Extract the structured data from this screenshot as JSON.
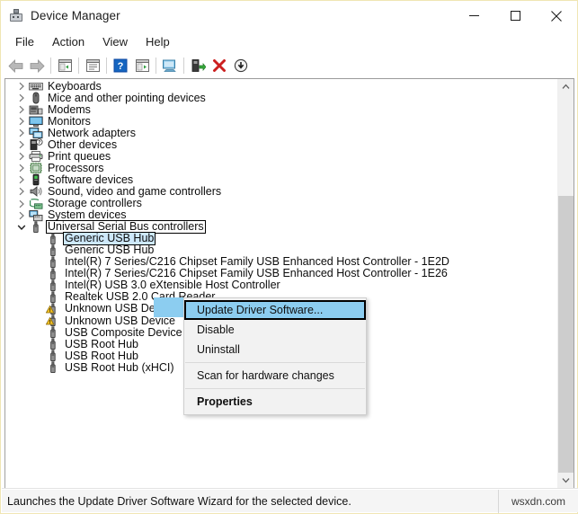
{
  "window": {
    "title": "Device Manager",
    "icon": "device-manager-icon",
    "border_color": "#f0e6b4",
    "caption_buttons": [
      {
        "name": "minimize-button",
        "glyph": "minimize"
      },
      {
        "name": "maximize-button",
        "glyph": "maximize"
      },
      {
        "name": "close-button",
        "glyph": "close"
      }
    ]
  },
  "menubar": {
    "items": [
      {
        "label": "File"
      },
      {
        "label": "Action"
      },
      {
        "label": "View"
      },
      {
        "label": "Help"
      }
    ]
  },
  "toolbar": {
    "buttons": [
      {
        "name": "back-icon",
        "tooltip": "Back"
      },
      {
        "name": "forward-icon",
        "tooltip": "Forward"
      },
      {
        "name": "show-hide-console-tree-icon",
        "tooltip": "Show/Hide Console Tree"
      },
      {
        "name": "properties-icon",
        "tooltip": "Properties"
      },
      {
        "name": "help-icon",
        "tooltip": "Help"
      },
      {
        "name": "action-menu-icon",
        "tooltip": "Action"
      },
      {
        "name": "update-driver-icon",
        "tooltip": "Update Driver Software"
      },
      {
        "name": "scan-hardware-changes-icon",
        "tooltip": "Scan for hardware changes"
      },
      {
        "name": "uninstall-icon",
        "tooltip": "Uninstall"
      },
      {
        "name": "disable-icon",
        "tooltip": "Disable"
      }
    ]
  },
  "tree": {
    "rows": [
      {
        "label": "Keyboards",
        "indent": 1,
        "expander": "collapsed",
        "icon": "keyboard-icon",
        "state": "normal"
      },
      {
        "label": "Mice and other pointing devices",
        "indent": 1,
        "expander": "collapsed",
        "icon": "mouse-icon",
        "state": "normal"
      },
      {
        "label": "Modems",
        "indent": 1,
        "expander": "collapsed",
        "icon": "modem-icon",
        "state": "normal"
      },
      {
        "label": "Monitors",
        "indent": 1,
        "expander": "collapsed",
        "icon": "monitor-icon",
        "state": "normal"
      },
      {
        "label": "Network adapters",
        "indent": 1,
        "expander": "collapsed",
        "icon": "network-icon",
        "state": "normal"
      },
      {
        "label": "Other devices",
        "indent": 1,
        "expander": "collapsed",
        "icon": "other-device-icon",
        "state": "normal"
      },
      {
        "label": "Print queues",
        "indent": 1,
        "expander": "collapsed",
        "icon": "printer-icon",
        "state": "normal"
      },
      {
        "label": "Processors",
        "indent": 1,
        "expander": "collapsed",
        "icon": "processor-icon",
        "state": "normal"
      },
      {
        "label": "Software devices",
        "indent": 1,
        "expander": "collapsed",
        "icon": "software-device-icon",
        "state": "normal"
      },
      {
        "label": "Sound, video and game controllers",
        "indent": 1,
        "expander": "collapsed",
        "icon": "sound-icon",
        "state": "normal"
      },
      {
        "label": "Storage controllers",
        "indent": 1,
        "expander": "collapsed",
        "icon": "storage-icon",
        "state": "normal"
      },
      {
        "label": "System devices",
        "indent": 1,
        "expander": "collapsed",
        "icon": "system-device-icon",
        "state": "normal"
      },
      {
        "label": "Universal Serial Bus controllers",
        "indent": 1,
        "expander": "expanded",
        "icon": "usb-icon",
        "state": "focused"
      },
      {
        "label": "Generic USB Hub",
        "indent": 2,
        "expander": "none",
        "icon": "usb-icon",
        "state": "selected-focused"
      },
      {
        "label": "Generic USB Hub",
        "indent": 2,
        "expander": "none",
        "icon": "usb-icon",
        "state": "normal"
      },
      {
        "label": "Intel(R) 7 Series/C216 Chipset Family USB Enhanced Host Controller - 1E2D",
        "indent": 2,
        "expander": "none",
        "icon": "usb-icon",
        "state": "normal"
      },
      {
        "label": "Intel(R) 7 Series/C216 Chipset Family USB Enhanced Host Controller - 1E26",
        "indent": 2,
        "expander": "none",
        "icon": "usb-icon",
        "state": "normal"
      },
      {
        "label": "Intel(R) USB 3.0 eXtensible Host Controller",
        "indent": 2,
        "expander": "none",
        "icon": "usb-icon",
        "state": "normal"
      },
      {
        "label": "Realtek USB 2.0 Card Reader",
        "indent": 2,
        "expander": "none",
        "icon": "usb-icon",
        "state": "normal"
      },
      {
        "label": "Unknown USB Device",
        "indent": 2,
        "expander": "none",
        "icon": "usb-warning-icon",
        "state": "normal"
      },
      {
        "label": "Unknown USB Device",
        "indent": 2,
        "expander": "none",
        "icon": "usb-warning-icon",
        "state": "normal"
      },
      {
        "label": "USB Composite Device",
        "indent": 2,
        "expander": "none",
        "icon": "usb-icon",
        "state": "normal"
      },
      {
        "label": "USB Root Hub",
        "indent": 2,
        "expander": "none",
        "icon": "usb-icon",
        "state": "normal"
      },
      {
        "label": "USB Root Hub",
        "indent": 2,
        "expander": "none",
        "icon": "usb-icon",
        "state": "normal"
      },
      {
        "label": "USB Root Hub (xHCI)",
        "indent": 2,
        "expander": "none",
        "icon": "usb-icon",
        "state": "normal"
      }
    ]
  },
  "context_menu": {
    "highlight_color": "#8ccdf0",
    "items": [
      {
        "label": "Update Driver Software...",
        "type": "item",
        "highlighted": true,
        "bold": false,
        "focused": true
      },
      {
        "label": "Disable",
        "type": "item",
        "highlighted": false,
        "bold": false,
        "focused": false
      },
      {
        "label": "Uninstall",
        "type": "item",
        "highlighted": false,
        "bold": false,
        "focused": false
      },
      {
        "type": "separator"
      },
      {
        "label": "Scan for hardware changes",
        "type": "item",
        "highlighted": false,
        "bold": false,
        "focused": false
      },
      {
        "type": "separator"
      },
      {
        "label": "Properties",
        "type": "item",
        "highlighted": false,
        "bold": true,
        "focused": false
      }
    ]
  },
  "scrollbar": {
    "up_arrow": "chevron-up-icon",
    "down_arrow": "chevron-down-icon"
  },
  "statusbar": {
    "text": "Launches the Update Driver Software Wizard for the selected device.",
    "watermark": "wsxdn.com"
  }
}
